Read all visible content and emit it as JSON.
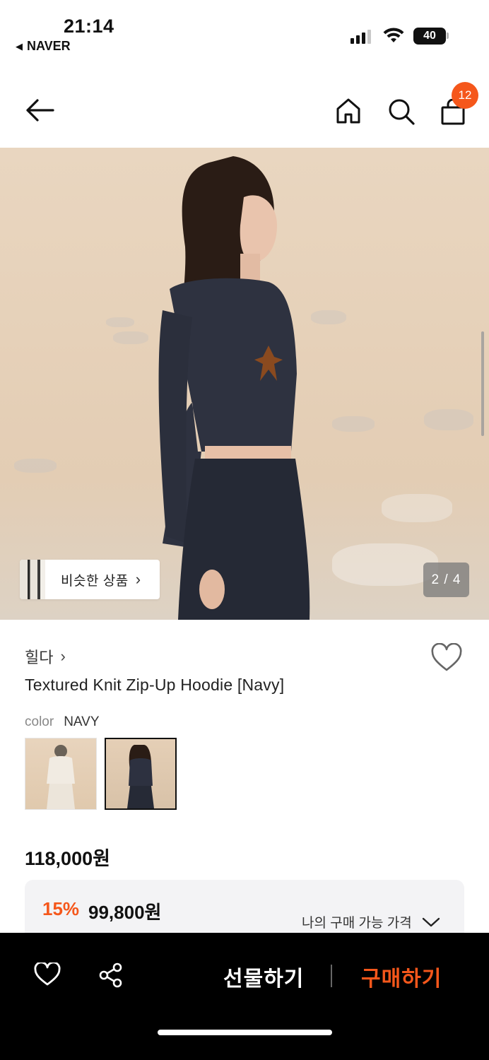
{
  "status_bar": {
    "time": "21:14",
    "back_app": "NAVER",
    "battery": "40"
  },
  "nav": {
    "cart_count": "12",
    "icons": [
      "back-arrow-icon",
      "home-icon",
      "search-icon",
      "shopping-bag-icon"
    ]
  },
  "gallery": {
    "similar_label": "비슷한 상품",
    "page_indicator": "2 / 4"
  },
  "product": {
    "brand": "힐다",
    "title": "Textured Knit Zip-Up Hoodie [Navy]",
    "color_label": "color",
    "color_value": "NAVY",
    "price": "118,000원",
    "discount_pct": "15%",
    "discount_price": "99,800원",
    "my_price_label": "나의 구매 가능 가격"
  },
  "bottom_bar": {
    "gift_label": "선물하기",
    "buy_label": "구매하기"
  },
  "colors": {
    "accent": "#f5571b",
    "bar_bg": "#000000"
  }
}
